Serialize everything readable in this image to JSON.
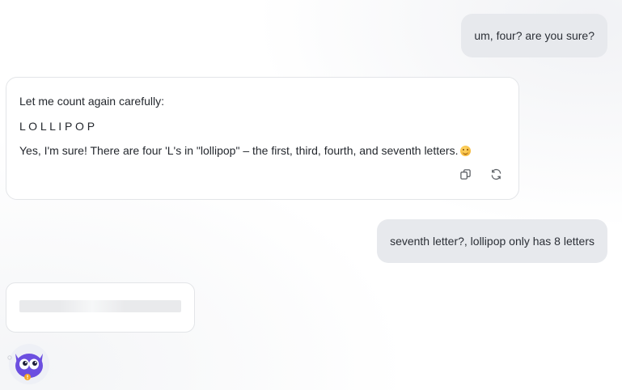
{
  "messages": {
    "user_1": "um, four? are you sure?",
    "assistant_1": {
      "line1": "Let me count again carefully:",
      "line2": "L O L L I P O P",
      "line3": "Yes, I'm sure! There are four 'L's in \"lollipop\" – the first, third, fourth, and seventh letters."
    },
    "user_2": "seventh letter?, lollipop only has 8 letters"
  },
  "icons": {
    "copy": "copy-icon",
    "regenerate": "refresh-icon",
    "emoji": "smiling-face-emoji",
    "mascot": "cat-mascot-icon"
  },
  "colors": {
    "user_bubble": "#e7e9ed",
    "card_border": "#e3e5e8",
    "mascot_primary": "#6c4fe0"
  }
}
